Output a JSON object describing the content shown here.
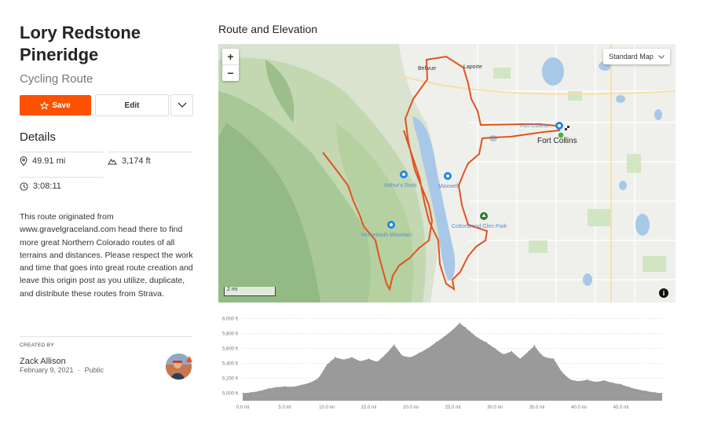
{
  "route": {
    "name": "Lory Redstone Pineridge",
    "type": "Cycling Route"
  },
  "actions": {
    "save_label": "Save",
    "edit_label": "Edit"
  },
  "details": {
    "heading": "Details",
    "distance": "49.91 mi",
    "elevation_gain": "3,174 ft",
    "est_time": "3:08:11"
  },
  "description": "This route originated from www.gravelgraceland.com head there to find more great Northern Colorado routes of all terrains and distances. Please respect the work and time that goes into great route creation and leave this origin post as you utilize, duplicate, and distribute these routes from Strava.",
  "creator": {
    "label": "CREATED BY",
    "name": "Zack Allison",
    "date": "February 9, 2021",
    "separator": "·",
    "visibility": "Public"
  },
  "map": {
    "section_title": "Route and Elevation",
    "zoom_in": "+",
    "zoom_out": "−",
    "map_type": "Standard Map",
    "scale": "2 mi",
    "info": "i",
    "places": {
      "bellvue": "Bellvue",
      "laporte": "Laporte",
      "fort_collins": "Fort Collins",
      "fort_collins_poi": "Fort Collins",
      "arthurs_rock": "Arthur's Rock",
      "maxwell": "Maxwell",
      "cottonwood": "Cottonwood Glen Park",
      "horsetooth": "Horsetooth Mountain"
    },
    "colors": {
      "route": "#e0531f",
      "water": "#a8c8e8",
      "forest": "#b5d4a4"
    }
  },
  "chart_data": {
    "type": "area",
    "xlabel": "",
    "ylabel": "",
    "xlim": [
      0,
      50
    ],
    "ylim": [
      4900,
      6100
    ],
    "x_ticks": [
      "0.0 mi",
      "5.0 mi",
      "10.0 mi",
      "15.0 mi",
      "20.0 mi",
      "25.0 mi",
      "30.0 mi",
      "35.0 mi",
      "40.0 mi",
      "45.0 mi"
    ],
    "y_ticks": [
      "5,000 ft",
      "5,200 ft",
      "5,400 ft",
      "5,600 ft",
      "5,800 ft",
      "6,000 ft"
    ],
    "x": [
      0,
      1,
      2,
      3,
      4,
      5,
      6,
      7,
      8,
      9,
      10,
      10.5,
      11,
      12,
      13,
      14,
      15,
      16,
      17,
      18,
      19,
      20,
      21,
      22,
      23,
      24,
      25,
      25.8,
      26.5,
      27,
      28,
      29,
      30,
      31,
      32,
      33,
      34,
      34.7,
      35.5,
      36,
      37,
      38,
      39,
      40,
      41,
      42,
      43,
      44,
      45,
      46,
      47,
      48,
      49,
      49.9
    ],
    "values": [
      5000,
      5010,
      5030,
      5060,
      5080,
      5090,
      5085,
      5110,
      5140,
      5200,
      5380,
      5430,
      5480,
      5450,
      5480,
      5430,
      5460,
      5420,
      5520,
      5650,
      5500,
      5480,
      5540,
      5600,
      5680,
      5760,
      5850,
      5940,
      5880,
      5830,
      5740,
      5680,
      5600,
      5520,
      5560,
      5460,
      5560,
      5640,
      5520,
      5480,
      5460,
      5280,
      5180,
      5160,
      5180,
      5150,
      5170,
      5140,
      5120,
      5080,
      5050,
      5030,
      5010,
      5000
    ],
    "grid": true,
    "fill_color": "#9a9a9a"
  }
}
